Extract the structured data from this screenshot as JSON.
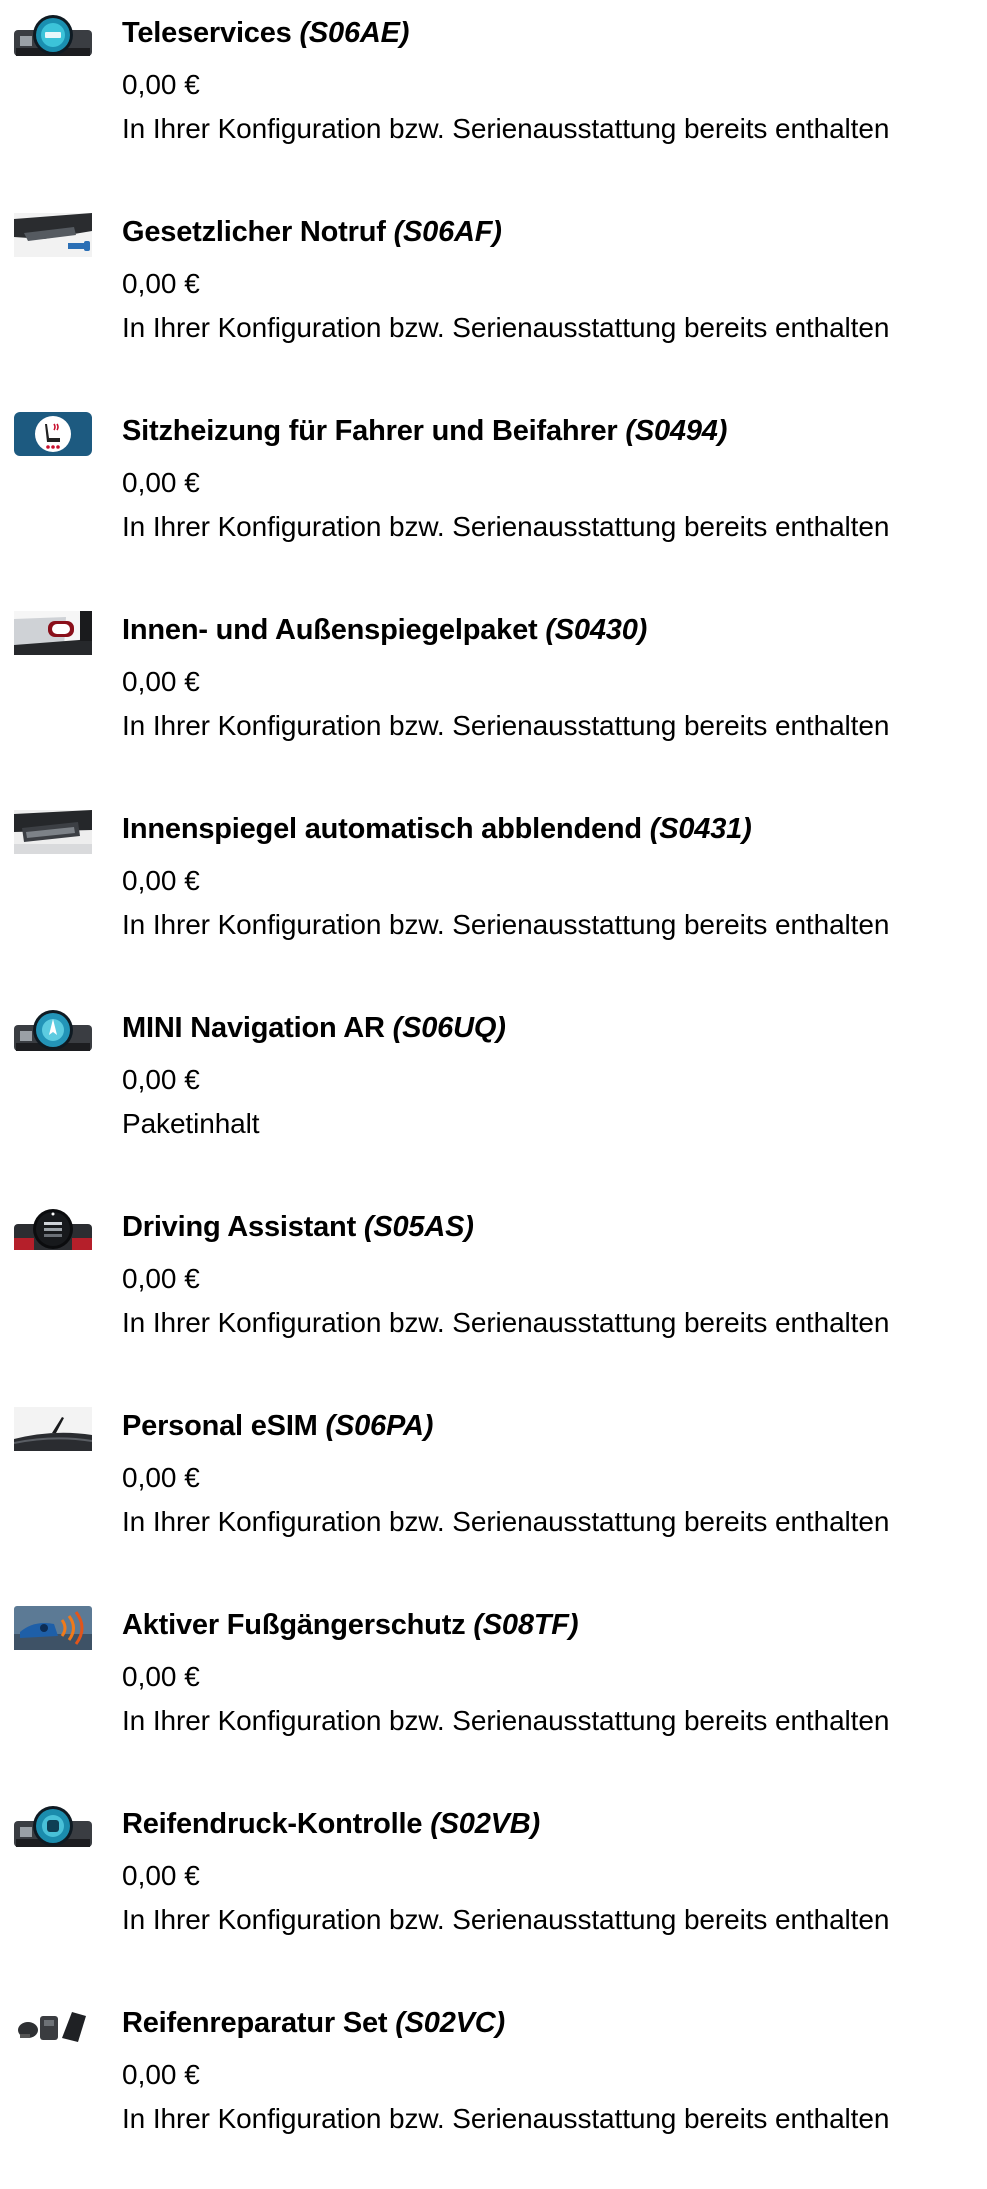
{
  "items": [
    {
      "name": "Teleservices",
      "code": "(S06AE)",
      "price": "0,00 €",
      "note": "In Ihrer Konfiguration bzw. Serienausstattung bereits enthalten",
      "icon": "dashboard-display-icon"
    },
    {
      "name": "Gesetzlicher Notruf",
      "code": "(S06AF)",
      "price": "0,00 €",
      "note": "In Ihrer Konfiguration bzw. Serienausstattung bereits enthalten",
      "icon": "emergency-call-roof-icon"
    },
    {
      "name": "Sitzheizung für Fahrer und Beifahrer",
      "code": "(S0494)",
      "price": "0,00 €",
      "note": "In Ihrer Konfiguration bzw. Serienausstattung bereits enthalten",
      "icon": "heated-seat-icon"
    },
    {
      "name": "Innen- und Außenspiegelpaket",
      "code": "(S0430)",
      "price": "0,00 €",
      "note": "In Ihrer Konfiguration bzw. Serienausstattung bereits enthalten",
      "icon": "mirror-icon"
    },
    {
      "name": "Innenspiegel automatisch abblendend",
      "code": "(S0431)",
      "price": "0,00 €",
      "note": "In Ihrer Konfiguration bzw. Serienausstattung bereits enthalten",
      "icon": "rearview-mirror-icon"
    },
    {
      "name": "MINI Navigation AR",
      "code": "(S06UQ)",
      "price": "0,00 €",
      "note": "Paketinhalt",
      "icon": "navigation-display-icon"
    },
    {
      "name": "Driving Assistant",
      "code": "(S05AS)",
      "price": "0,00 €",
      "note": "In Ihrer Konfiguration bzw. Serienausstattung bereits enthalten",
      "icon": "driving-assistant-display-icon"
    },
    {
      "name": "Personal eSIM",
      "code": "(S06PA)",
      "price": "0,00 €",
      "note": "In Ihrer Konfiguration bzw. Serienausstattung bereits enthalten",
      "icon": "roof-antenna-icon"
    },
    {
      "name": "Aktiver Fußgängerschutz",
      "code": "(S08TF)",
      "price": "0,00 €",
      "note": "In Ihrer Konfiguration bzw. Serienausstattung bereits enthalten",
      "icon": "pedestrian-protection-icon"
    },
    {
      "name": "Reifendruck-Kontrolle",
      "code": "(S02VB)",
      "price": "0,00 €",
      "note": "In Ihrer Konfiguration bzw. Serienausstattung bereits enthalten",
      "icon": "tire-pressure-display-icon"
    },
    {
      "name": "Reifenreparatur Set",
      "code": "(S02VC)",
      "price": "0,00 €",
      "note": "In Ihrer Konfiguration bzw. Serienausstattung bereits enthalten",
      "icon": "tire-repair-kit-icon"
    }
  ]
}
